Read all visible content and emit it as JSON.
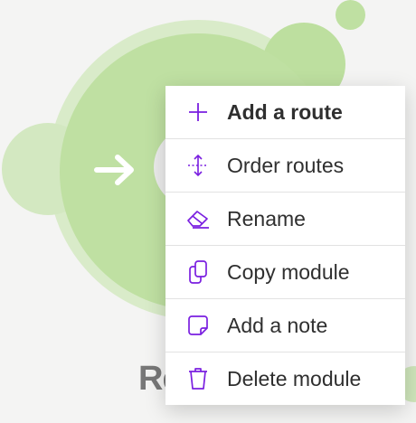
{
  "canvas": {
    "module_label_partial": "Re"
  },
  "menu": {
    "accent": "#7a1fe0",
    "items": [
      {
        "label": "Add a route",
        "icon": "plus-icon"
      },
      {
        "label": "Order routes",
        "icon": "order-icon"
      },
      {
        "label": "Rename",
        "icon": "eraser-icon"
      },
      {
        "label": "Copy module",
        "icon": "copy-icon"
      },
      {
        "label": "Add a note",
        "icon": "note-icon"
      },
      {
        "label": "Delete module",
        "icon": "trash-icon"
      }
    ]
  }
}
